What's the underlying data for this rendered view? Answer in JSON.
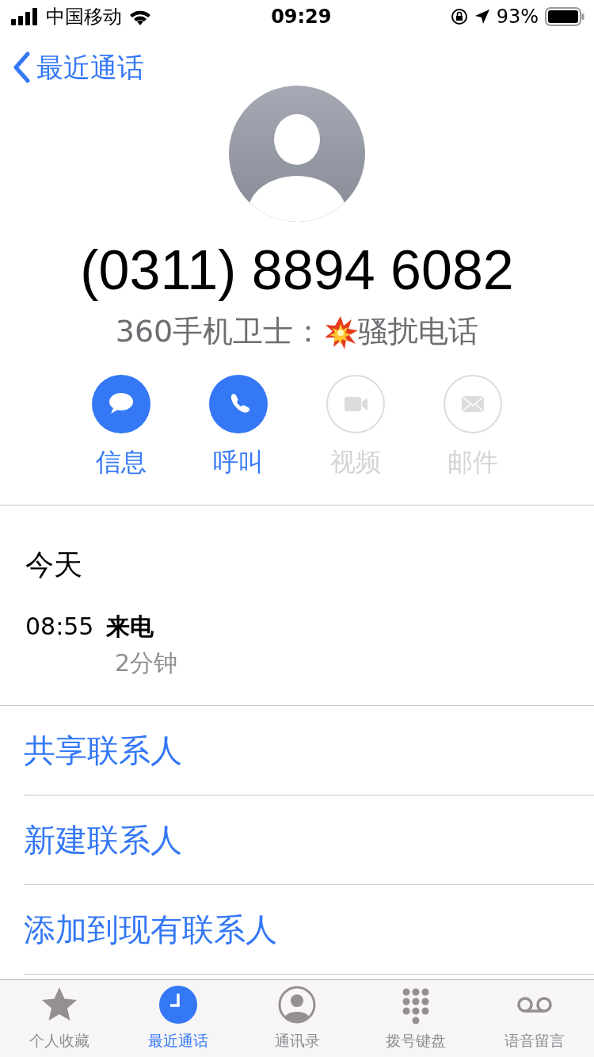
{
  "status_bar": {
    "carrier": "中国移动",
    "time": "09:29",
    "battery": "93%"
  },
  "nav": {
    "back_label": "最近通话"
  },
  "contact": {
    "number": "(0311) 8894 6082",
    "label_source": "360手机卫士：",
    "label_tag": "骚扰电话"
  },
  "actions": [
    {
      "kind": "message",
      "label": "信息",
      "disabled": false
    },
    {
      "kind": "call",
      "label": "呼叫",
      "disabled": false
    },
    {
      "kind": "video",
      "label": "视频",
      "disabled": true
    },
    {
      "kind": "mail",
      "label": "邮件",
      "disabled": true
    }
  ],
  "history": {
    "day": "今天",
    "entries": [
      {
        "time": "08:55",
        "type": "来电",
        "duration": "2分钟"
      }
    ]
  },
  "options": [
    "共享联系人",
    "新建联系人",
    "添加到现有联系人"
  ],
  "tab_bar": [
    {
      "kind": "favorites",
      "label": "个人收藏",
      "selected": false
    },
    {
      "kind": "recents",
      "label": "最近通话",
      "selected": true
    },
    {
      "kind": "contacts",
      "label": "通讯录",
      "selected": false
    },
    {
      "kind": "keypad",
      "label": "拨号键盘",
      "selected": false
    },
    {
      "kind": "voicemail",
      "label": "语音留言",
      "selected": false
    }
  ]
}
